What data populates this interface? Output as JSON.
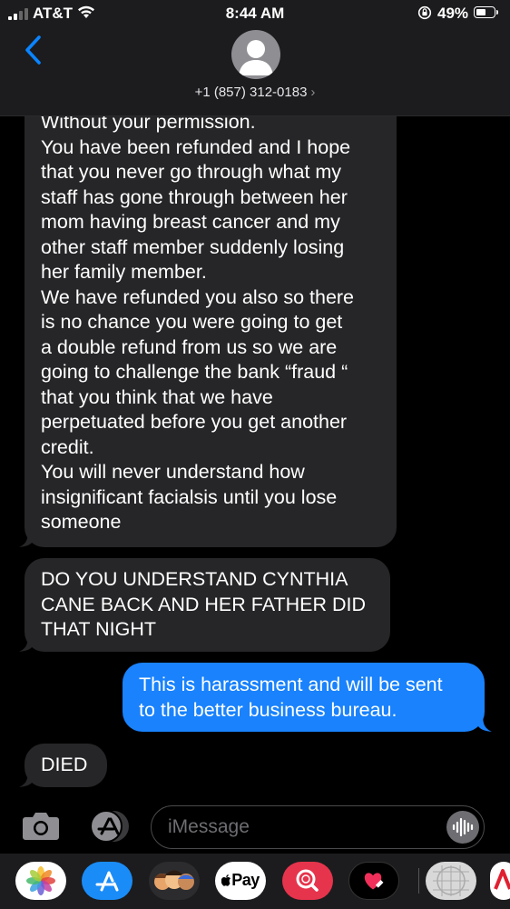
{
  "status_bar": {
    "carrier": "AT&T",
    "time": "8:44 AM",
    "battery_percent": "49%",
    "battery_level": 0.49
  },
  "header": {
    "contact": "+1 (857) 312-0183",
    "chevron": "›"
  },
  "messages": [
    {
      "direction": "received",
      "lines": [
        "Without your permission.",
        "You have been refunded and I hope",
        "that you never go through what my",
        "staff has gone through between her",
        "mom having breast cancer and my",
        "other staff member suddenly losing",
        "her family member.",
        "We have refunded you also so there",
        "is no chance you were going to get",
        "a double refund from us so we are",
        "going to challenge the bank “fraud “",
        "that you think that we have",
        "perpetuated before you get another",
        "credit.",
        "You will never understand how",
        "insignificant facialsis until you lose",
        "someone"
      ]
    },
    {
      "direction": "received",
      "lines": [
        "DO YOU UNDERSTAND CYNTHIA",
        "CANE BACK AND HER FATHER DID",
        "THAT NIGHT"
      ]
    },
    {
      "direction": "sent",
      "lines": [
        "This is harassment and will be sent",
        "to the better business bureau."
      ]
    },
    {
      "direction": "received",
      "lines": [
        "DIED"
      ]
    }
  ],
  "input": {
    "placeholder": "iMessage"
  },
  "app_drawer": {
    "apple_pay_label": "Pay",
    "apps": [
      "photos-icon",
      "app-store-icon",
      "memoji-icon",
      "apple-pay-icon",
      "search-images-icon",
      "digital-touch-icon",
      "grid-app-icon",
      "partial-app-icon"
    ]
  },
  "colors": {
    "sent_bubble": "#1982fc",
    "received_bubble": "#262628",
    "accent": "#0a84ff"
  }
}
